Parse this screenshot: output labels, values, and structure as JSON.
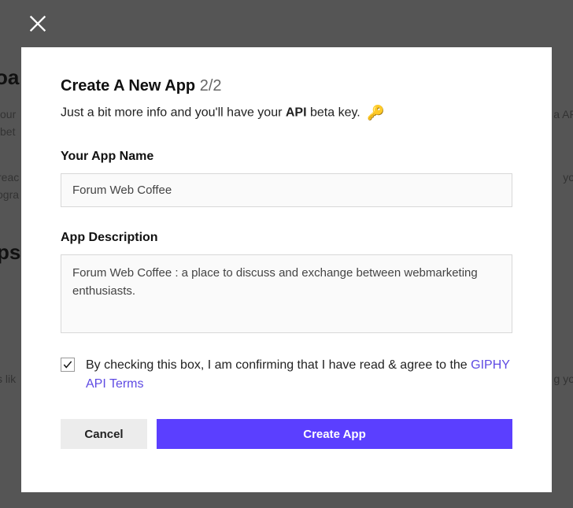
{
  "background": {
    "heading1": "oa",
    "line1": "our",
    "line2": "bet",
    "line3": "reac",
    "line4": "ogra",
    "heading2": "ps",
    "line5": "s lik",
    "right1": "a AF",
    "right2": "yo",
    "right3": "g yo"
  },
  "modal": {
    "title": "Create A New App",
    "step": "2/2",
    "subtitle_prefix": "Just a bit more info and you'll have your ",
    "subtitle_bold": "API",
    "subtitle_suffix": " beta key.",
    "key_emoji": "🔑",
    "name_label": "Your App Name",
    "name_value": "Forum Web Coffee",
    "desc_label": "App Description",
    "desc_value": "Forum Web Coffee : a place to discuss and exchange between webmarketing enthusiasts.",
    "consent_text": "By checking this box, I am confirming that I have read & agree to the ",
    "consent_link": "GIPHY API Terms",
    "cancel_label": "Cancel",
    "submit_label": "Create App"
  }
}
